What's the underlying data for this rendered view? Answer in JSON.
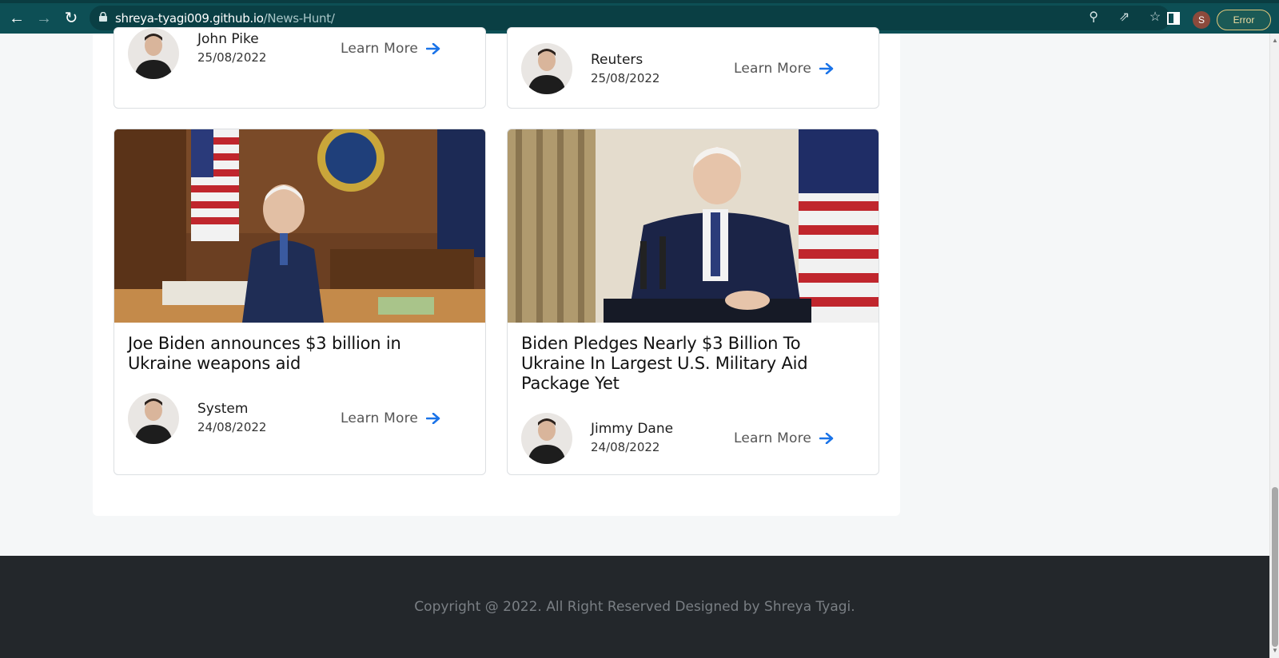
{
  "browser": {
    "url_host": "shreya-tyagi009.github.io",
    "url_path": "/News-Hunt/",
    "profile_initial": "S",
    "error_label": "Error"
  },
  "cards": [
    {
      "title": "",
      "author": "John Pike",
      "date": "25/08/2022",
      "cta": "Learn More"
    },
    {
      "title": "",
      "author": "Reuters",
      "date": "25/08/2022",
      "cta": "Learn More"
    },
    {
      "title": "Joe Biden announces $3 billion in Ukraine weapons aid",
      "author": "System",
      "date": "24/08/2022",
      "cta": "Learn More"
    },
    {
      "title": "Biden Pledges Nearly $3 Billion To Ukraine In Largest U.S. Military Aid Package Yet",
      "author": "Jimmy Dane",
      "date": "24/08/2022",
      "cta": "Learn More"
    }
  ],
  "footer": {
    "copyright": "Copyright @ 2022. All Right Reserved Designed by Shreya Tyagi."
  },
  "colors": {
    "accent": "#1a73e8",
    "toolbar": "#0d4f55",
    "footer": "#23272b"
  }
}
